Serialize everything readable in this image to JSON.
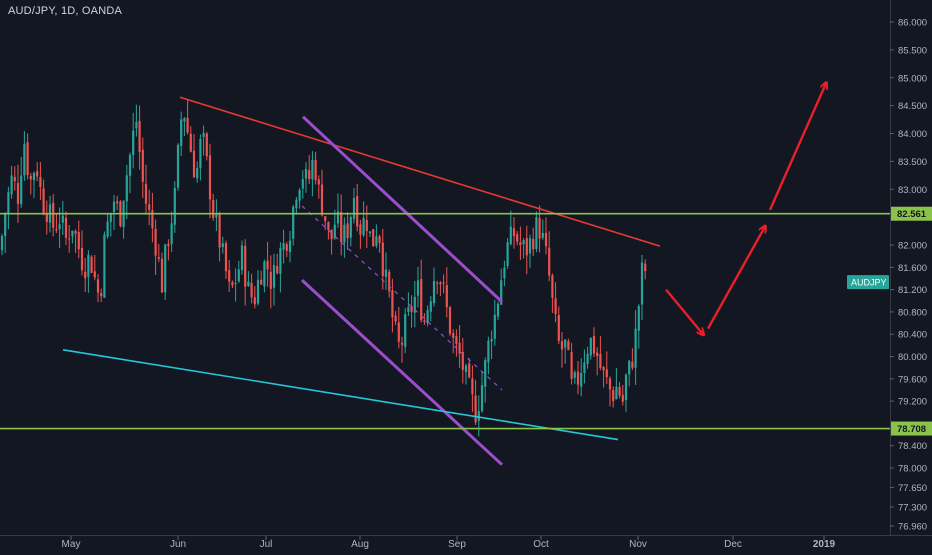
{
  "chart_data": {
    "type": "candlestick",
    "title": "AUD/JPY, 1D, OANDA",
    "symbol_tag": "AUDJPY",
    "y_ticks": [
      "86.000",
      "85.500",
      "85.000",
      "84.500",
      "84.000",
      "83.500",
      "83.000",
      "82.000",
      "81.600",
      "81.200",
      "80.800",
      "80.400",
      "80.000",
      "79.600",
      "79.200",
      "78.400",
      "78.000",
      "77.650",
      "77.300",
      "76.960"
    ],
    "x_ticks": [
      "May",
      "Jun",
      "Jul",
      "Aug",
      "Sep",
      "Oct",
      "Nov",
      "Dec",
      "2019"
    ],
    "horizontal_levels": [
      {
        "label": "82.561",
        "value": 82.561,
        "color": "#8bc34a"
      },
      {
        "label": "78.708",
        "value": 78.708,
        "color": "#8bc34a"
      }
    ],
    "last_price": 81.55,
    "colors": {
      "up": "#26a69a",
      "down": "#ef5350",
      "resistance": "#e53935",
      "channel": "#9c4dcc",
      "support": "#26c6da",
      "arrow": "#e8202a",
      "background": "#131722"
    },
    "anchors": {
      "start_date": "2018-04-16",
      "x0": 0,
      "days_span": 280,
      "x1": 890,
      "price_top": 86.0,
      "y_top": 22,
      "price_bottom": 76.96,
      "y_bottom": 526
    },
    "ohlc_path": [
      [
        0,
        81.9
      ],
      [
        6,
        82.7
      ],
      [
        12,
        83.2
      ],
      [
        18,
        82.9
      ],
      [
        24,
        83.9
      ],
      [
        30,
        83.1
      ],
      [
        36,
        83.5
      ],
      [
        42,
        82.8
      ],
      [
        48,
        82.6
      ],
      [
        54,
        82.3
      ],
      [
        60,
        82.5
      ],
      [
        66,
        82.1
      ],
      [
        72,
        82.4
      ],
      [
        78,
        82.0
      ],
      [
        84,
        81.6
      ],
      [
        90,
        81.8
      ],
      [
        96,
        81.3
      ],
      [
        100,
        81.0
      ],
      [
        104,
        82.0
      ],
      [
        108,
        82.4
      ],
      [
        114,
        82.8
      ],
      [
        120,
        82.5
      ],
      [
        124,
        83.0
      ],
      [
        130,
        83.6
      ],
      [
        136,
        84.3
      ],
      [
        140,
        83.6
      ],
      [
        144,
        82.9
      ],
      [
        150,
        82.5
      ],
      [
        156,
        82.0
      ],
      [
        162,
        81.3
      ],
      [
        166,
        81.9
      ],
      [
        170,
        82.3
      ],
      [
        176,
        83.0
      ],
      [
        180,
        84.2
      ],
      [
        184,
        84.4
      ],
      [
        190,
        83.8
      ],
      [
        196,
        83.2
      ],
      [
        202,
        84.0
      ],
      [
        208,
        83.3
      ],
      [
        212,
        82.7
      ],
      [
        218,
        82.2
      ],
      [
        224,
        81.7
      ],
      [
        230,
        81.1
      ],
      [
        236,
        81.4
      ],
      [
        242,
        81.8
      ],
      [
        248,
        81.2
      ],
      [
        254,
        81.0
      ],
      [
        260,
        81.5
      ],
      [
        266,
        81.7
      ],
      [
        272,
        81.3
      ],
      [
        278,
        81.8
      ],
      [
        284,
        82.0
      ],
      [
        290,
        82.3
      ],
      [
        296,
        83.0
      ],
      [
        302,
        83.3
      ],
      [
        308,
        83.1
      ],
      [
        314,
        83.6
      ],
      [
        318,
        83.0
      ],
      [
        324,
        82.6
      ],
      [
        330,
        82.0
      ],
      [
        336,
        82.5
      ],
      [
        342,
        82.1
      ],
      [
        348,
        82.3
      ],
      [
        354,
        82.9
      ],
      [
        360,
        82.3
      ],
      [
        366,
        82.5
      ],
      [
        372,
        82.0
      ],
      [
        378,
        82.4
      ],
      [
        384,
        81.5
      ],
      [
        390,
        81.0
      ],
      [
        394,
        80.5
      ],
      [
        400,
        80.1
      ],
      [
        406,
        80.6
      ],
      [
        412,
        80.9
      ],
      [
        418,
        81.2
      ],
      [
        424,
        80.6
      ],
      [
        430,
        81.1
      ],
      [
        436,
        81.6
      ],
      [
        442,
        81.3
      ],
      [
        448,
        80.7
      ],
      [
        454,
        80.2
      ],
      [
        460,
        80.0
      ],
      [
        466,
        79.6
      ],
      [
        472,
        79.2
      ],
      [
        476,
        79.0
      ],
      [
        480,
        79.3
      ],
      [
        486,
        79.9
      ],
      [
        490,
        80.4
      ],
      [
        496,
        80.8
      ],
      [
        500,
        81.3
      ],
      [
        504,
        81.7
      ],
      [
        508,
        82.0
      ],
      [
        514,
        82.2
      ],
      [
        520,
        82.0
      ],
      [
        526,
        81.9
      ],
      [
        532,
        82.1
      ],
      [
        538,
        82.4
      ],
      [
        544,
        82.0
      ],
      [
        548,
        81.6
      ],
      [
        552,
        81.0
      ],
      [
        556,
        80.5
      ],
      [
        560,
        80.1
      ],
      [
        566,
        80.2
      ],
      [
        572,
        79.4
      ],
      [
        578,
        79.6
      ],
      [
        584,
        80.0
      ],
      [
        590,
        80.3
      ],
      [
        596,
        80.1
      ],
      [
        602,
        79.7
      ],
      [
        608,
        79.5
      ],
      [
        612,
        79.3
      ],
      [
        618,
        79.5
      ],
      [
        622,
        79.1
      ],
      [
        626,
        79.6
      ],
      [
        630,
        79.8
      ],
      [
        634,
        80.1
      ],
      [
        638,
        80.8
      ],
      [
        642,
        81.5
      ],
      [
        648,
        81.6
      ]
    ],
    "annotations": {
      "resistance_line": [
        [
          180,
          84.65
        ],
        [
          660,
          81.98
        ]
      ],
      "channel_upper": [
        [
          303,
          84.3
        ],
        [
          502,
          80.98
        ]
      ],
      "channel_lower": [
        [
          302,
          81.37
        ],
        [
          502,
          78.06
        ]
      ],
      "channel_mid": [
        [
          302,
          82.7
        ],
        [
          502,
          79.4
        ]
      ],
      "support_line": [
        [
          63,
          80.12
        ],
        [
          618,
          78.51
        ]
      ],
      "arrows": [
        [
          [
            666,
            81.2
          ],
          [
            703,
            80.4
          ]
        ],
        [
          [
            708,
            80.5
          ],
          [
            765,
            82.33
          ]
        ],
        [
          [
            770,
            82.63
          ],
          [
            826,
            84.9
          ]
        ]
      ]
    }
  }
}
